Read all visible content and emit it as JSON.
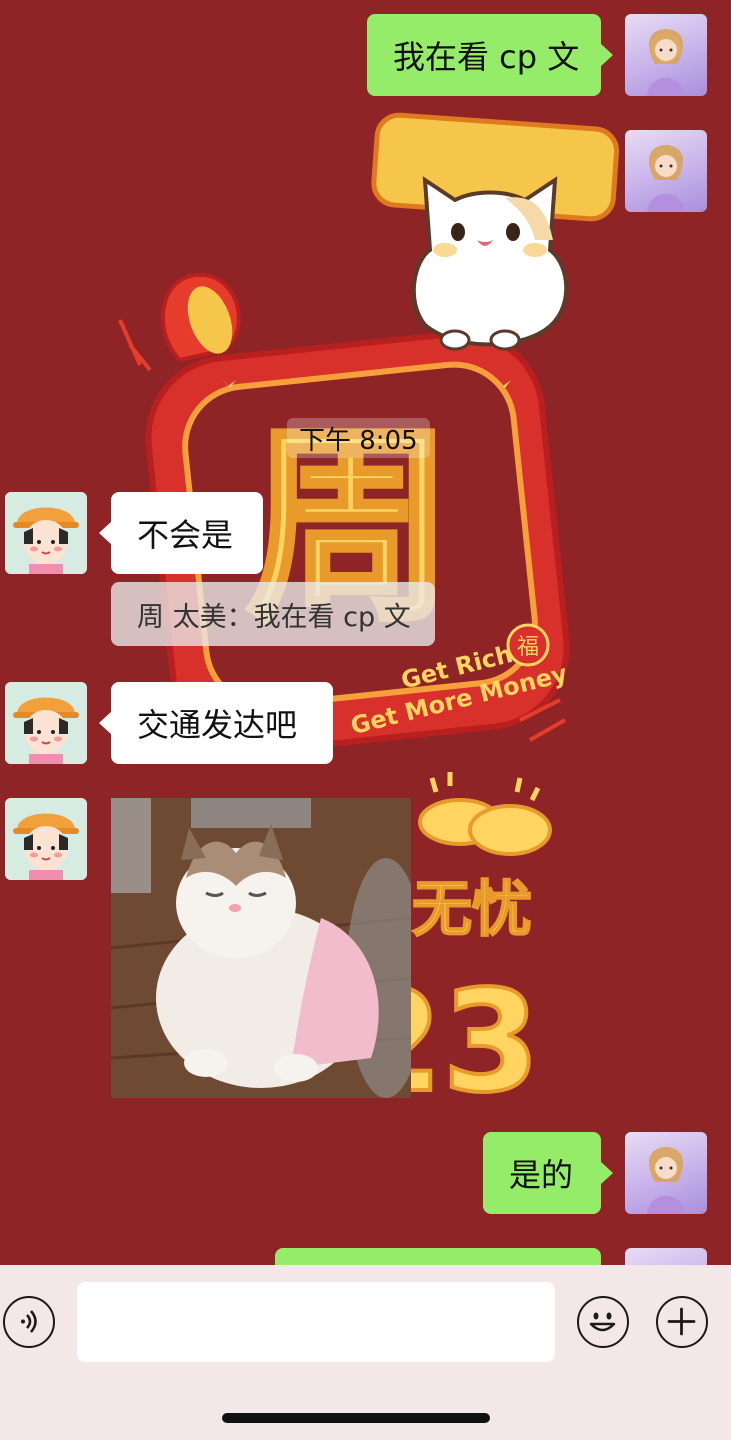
{
  "messages": [
    {
      "text": "我在看 cp 文"
    },
    {
      "text": "不会是"
    },
    {
      "text": "交通发达吧"
    },
    {
      "text": "是的"
    }
  ],
  "time_label": "下午 8:05",
  "quote": {
    "text": "周 太美：我在看 cp 文"
  },
  "wallpaper": {
    "badge_char": "周",
    "slogan_line1": "Get Rich",
    "slogan_line2": "Get More Money",
    "fu_char": "福",
    "partial_text": "无忧",
    "partial_number": "23"
  },
  "colors": {
    "background": "#8e2426",
    "my_bubble": "#95ec69",
    "other_bubble": "#ffffff",
    "input_bar": "#f4e7e7"
  },
  "icons": [
    "voice-icon",
    "emoji-icon",
    "add-icon"
  ]
}
